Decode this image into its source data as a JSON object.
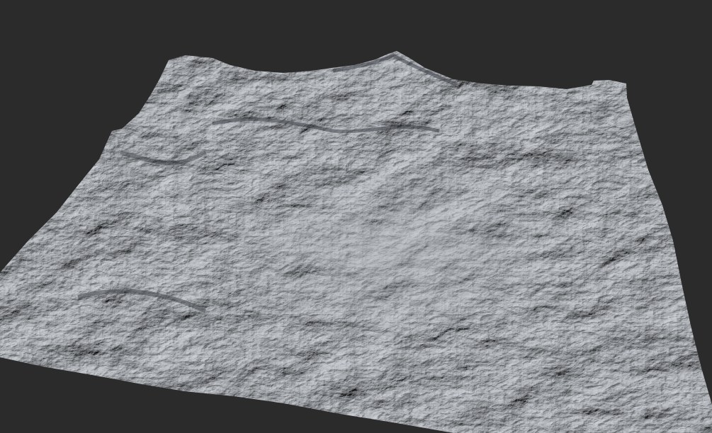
{
  "scene": {
    "background_color": "#2b2b2b",
    "subject": "terrain-heightmap-render",
    "terrain": {
      "base_color": "#9ea3a9",
      "highlight_color": "#c3c7cc",
      "shadow_color": "#3e4248"
    }
  }
}
